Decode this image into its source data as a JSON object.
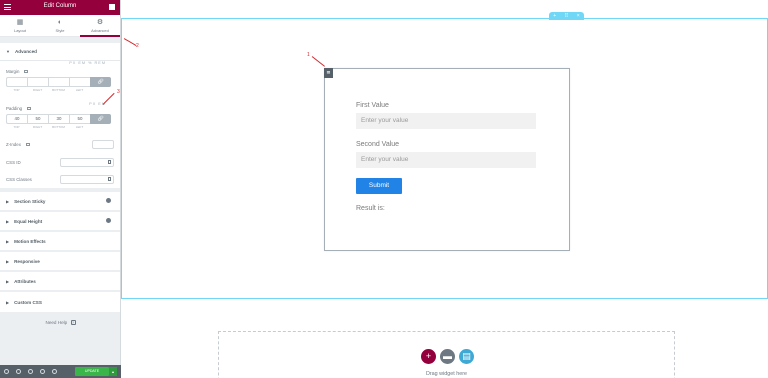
{
  "panel": {
    "title": "Edit Column",
    "tabs": [
      {
        "label": "Layout",
        "icon": "layout-icon"
      },
      {
        "label": "Style",
        "icon": "style-icon"
      },
      {
        "label": "Advanced",
        "icon": "gear-icon",
        "active": true
      }
    ],
    "advanced": {
      "heading": "Advanced",
      "margin": {
        "label": "Margin",
        "units": "PX EM %  REM",
        "values": [
          "",
          "",
          "",
          ""
        ],
        "sub_labels": [
          "TOP",
          "RIGHT",
          "BOTTOM",
          "LEFT"
        ]
      },
      "padding": {
        "label": "Padding",
        "units": "PX EM",
        "values": [
          "40",
          "50",
          "30",
          "50"
        ],
        "sub_labels": [
          "TOP",
          "RIGHT",
          "BOTTOM",
          "LEFT"
        ]
      },
      "zindex": {
        "label": "Z-Index",
        "value": ""
      },
      "css_id": {
        "label": "CSS ID",
        "value": ""
      },
      "css_classes": {
        "label": "CSS Classes",
        "value": ""
      }
    },
    "sections": [
      "Section Sticky",
      "Equal Height",
      "Motion Effects",
      "Responsive",
      "Attributes",
      "Custom CSS"
    ],
    "need_help": "Need Help",
    "footer": {
      "update": "UPDATE"
    }
  },
  "preview": {
    "form": {
      "first_label": "First Value",
      "first_placeholder": "Enter your value",
      "second_label": "Second Value",
      "second_placeholder": "Enter your value",
      "submit": "Submit",
      "result": "Result is:"
    },
    "drop_text": "Drag widget here"
  },
  "annotations": {
    "one": "1",
    "two": "2",
    "three": "3"
  },
  "colors": {
    "brand": "#93003c",
    "accent_blue": "#2283e6",
    "outline": "#71d7f7",
    "update_green": "#39b54a"
  }
}
